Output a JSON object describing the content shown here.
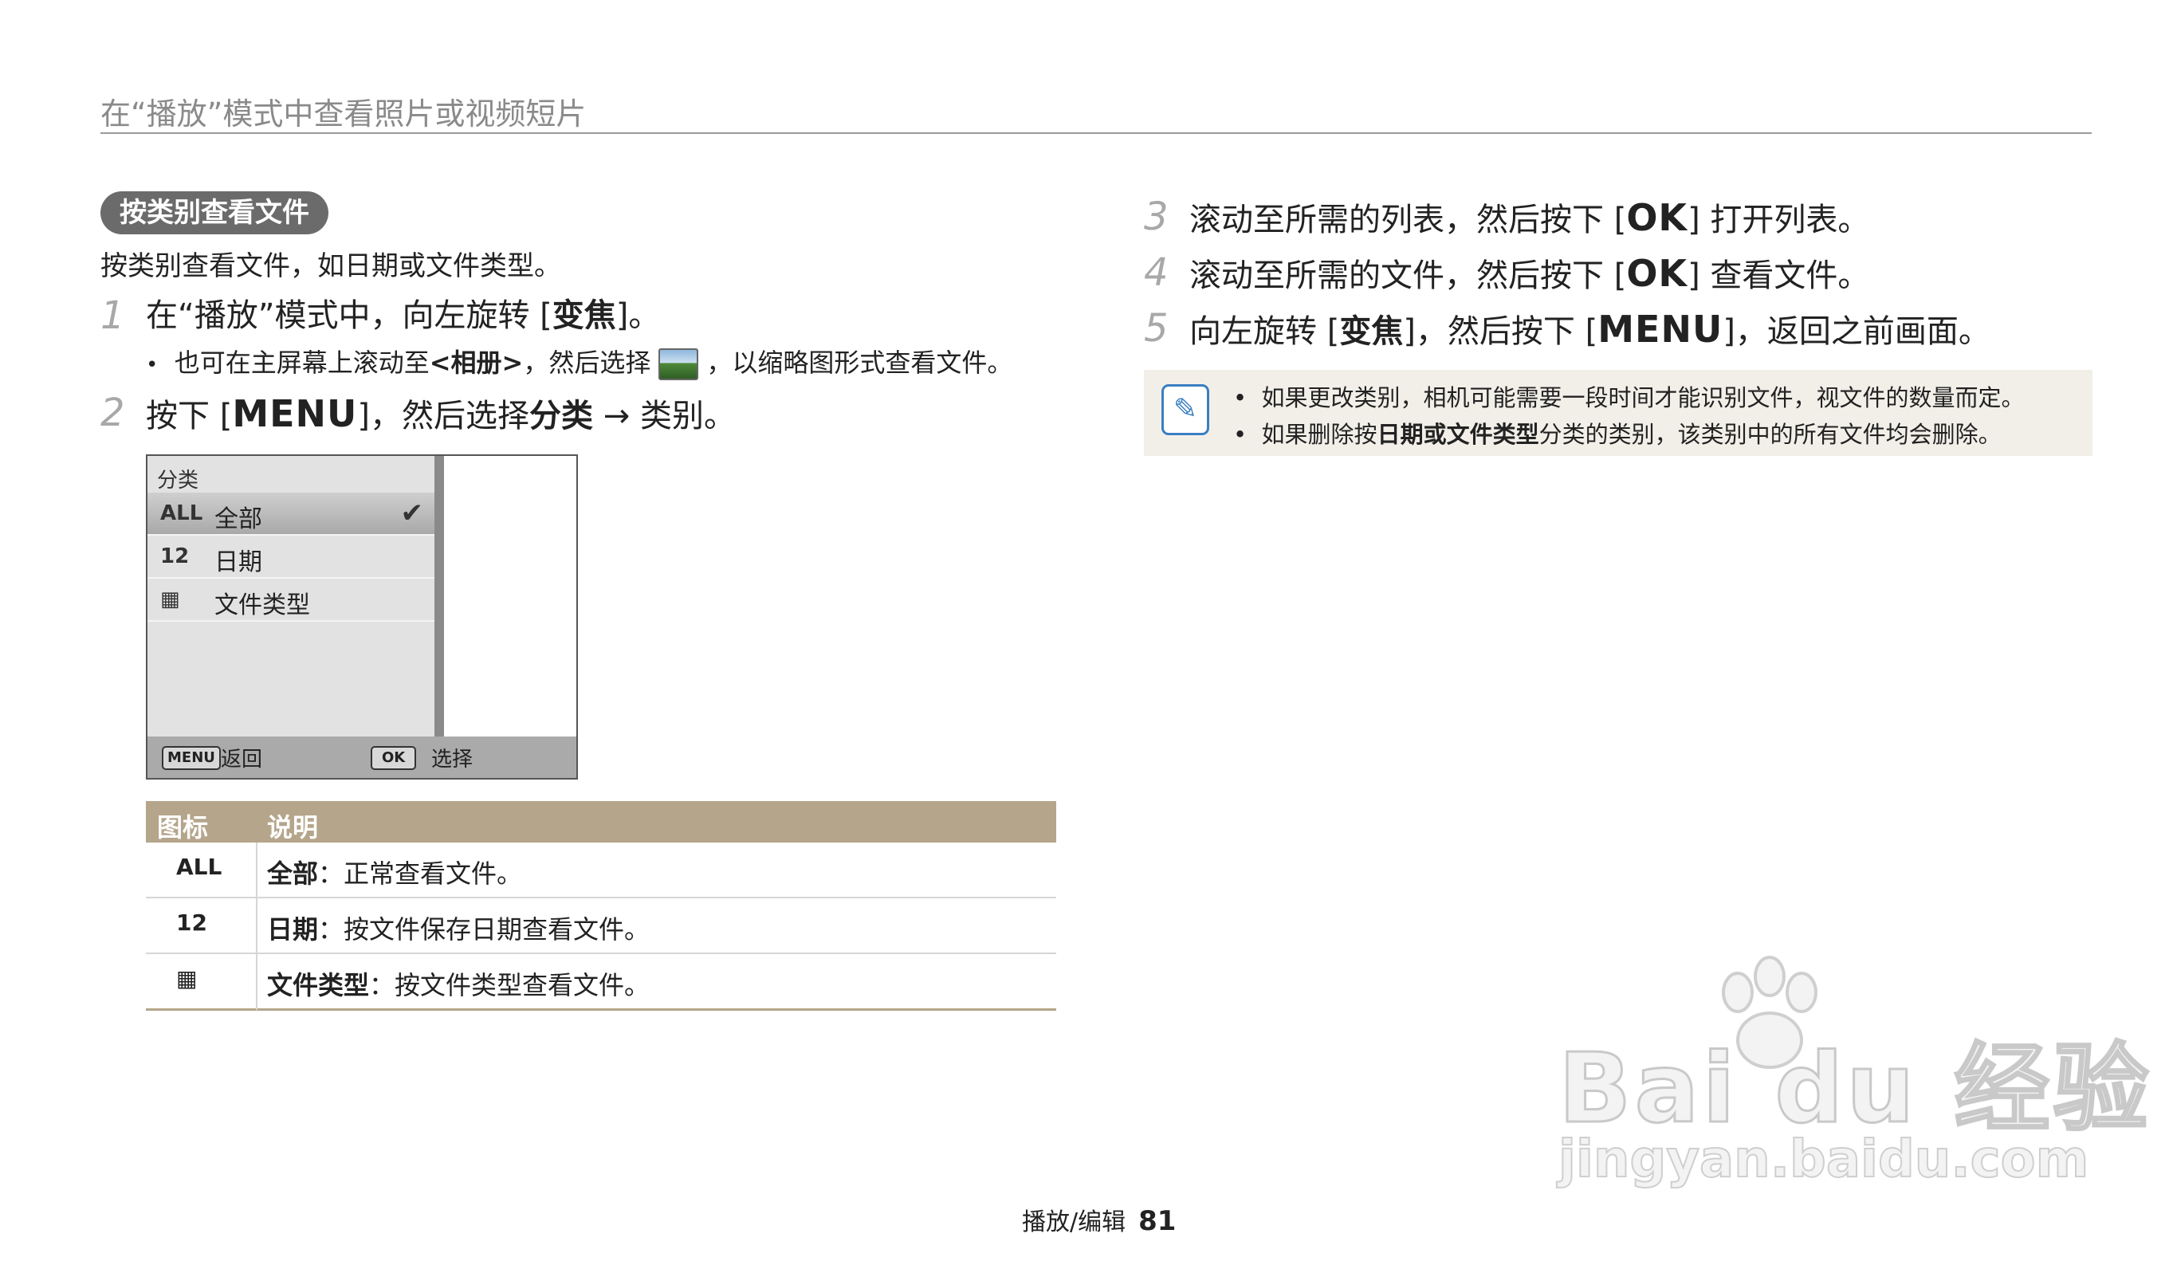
{
  "header": {
    "title": "在“播放”模式中查看照片或视频短片"
  },
  "section": {
    "pill": "按类别查看文件",
    "intro": "按类别查看文件，如日期或文件类型。"
  },
  "steps": {
    "s1": {
      "num": "1",
      "pre": "在“播放”模式中，向左旋转 [",
      "key": "变焦",
      "post": "]。"
    },
    "s1_bullet": {
      "pre": "也可在主屏幕上滚动至",
      "key": "<相册>",
      "mid": "，然后选择",
      "post": "，以缩略图形式查看文件。"
    },
    "s2": {
      "num": "2",
      "pre": "按下 [",
      "key": "MENU",
      "mid": "]，然后选择",
      "key2": "分类",
      "post": " → 类别。"
    },
    "s3": {
      "num": "3",
      "pre": "滚动至所需的列表，然后按下 [",
      "key": "OK",
      "post": "] 打开列表。"
    },
    "s4": {
      "num": "4",
      "pre": "滚动至所需的文件，然后按下 [",
      "key": "OK",
      "post": "] 查看文件。"
    },
    "s5": {
      "num": "5",
      "pre": "向左旋转 [",
      "key": "变焦",
      "mid": "]，然后按下 [",
      "key2": "MENU",
      "post": "]，返回之前画面。"
    }
  },
  "camera_screen": {
    "heading": "分类",
    "items": [
      {
        "icon": "ALL",
        "label": "全部",
        "selected": true
      },
      {
        "icon": "12",
        "label": "日期",
        "selected": false
      },
      {
        "icon": "▦",
        "label": "文件类型",
        "selected": false
      }
    ],
    "footer": {
      "menu_key": "MENU",
      "menu_label": "返回",
      "ok_key": "OK",
      "ok_label": "选择"
    }
  },
  "table": {
    "headers": [
      "图标",
      "说明"
    ],
    "rows": [
      {
        "icon": "ALL",
        "term": "全部",
        "text": "：正常查看文件。"
      },
      {
        "icon": "12",
        "term": "日期",
        "text": "：按文件保存日期查看文件。"
      },
      {
        "icon": "▦",
        "term": "文件类型",
        "text": "：按文件类型查看文件。"
      }
    ]
  },
  "note": {
    "line1": "如果更改类别，相机可能需要一段时间才能识别文件，视文件的数量而定。",
    "line2_pre": "如果删除按",
    "line2_key": "日期或文件类型",
    "line2_post": "分类的类别，该类别中的所有文件均会删除。"
  },
  "watermark": {
    "brand": "Bai du 经验",
    "url": "jingyan.baidu.com"
  },
  "footer": {
    "section": "播放/编辑",
    "page": "81"
  },
  "colors": {
    "accent_tan": "#b5a58b",
    "note_bg": "#f2efe9",
    "note_icon": "#3a7fc1",
    "pill_bg": "#6b6b6b"
  }
}
